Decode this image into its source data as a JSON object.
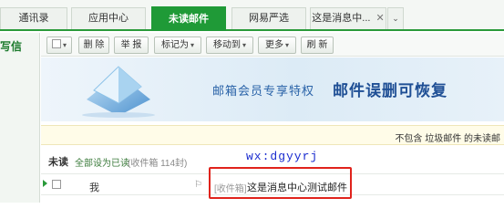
{
  "tabs": [
    {
      "label": "通讯录",
      "active": false
    },
    {
      "label": "应用中心",
      "active": false
    },
    {
      "label": "未读邮件",
      "active": true
    },
    {
      "label": "网易严选",
      "active": false
    },
    {
      "label": "这是消息中...",
      "active": false,
      "closable": true
    }
  ],
  "left": {
    "write_label": "写信"
  },
  "toolbar": {
    "delete": "删 除",
    "report": "举 报",
    "mark_as": "标记为",
    "move_to": "移动到",
    "more": "更多",
    "refresh": "刷 新"
  },
  "banner": {
    "text1": "邮箱会员专享特权",
    "text2": "邮件误删可恢复"
  },
  "notice": {
    "text": "不包含 垃圾邮件 的未读邮"
  },
  "list_header": {
    "title": "未读",
    "mark_all_read": "全部设为已读",
    "count_text": "(收件箱 114封)"
  },
  "watermark": "wx:dgyyrj",
  "messages": [
    {
      "sender": "我",
      "folder": "[收件箱]",
      "subject": "这是消息中心测试邮件"
    }
  ],
  "colors": {
    "accent": "#1f9a37",
    "highlight_box": "#e0231c",
    "banner_title": "#1f4f95"
  },
  "icons": [
    "close-icon",
    "chevron-down-icon",
    "banner-envelope-icon",
    "flag-icon",
    "unread-arrow-icon"
  ]
}
